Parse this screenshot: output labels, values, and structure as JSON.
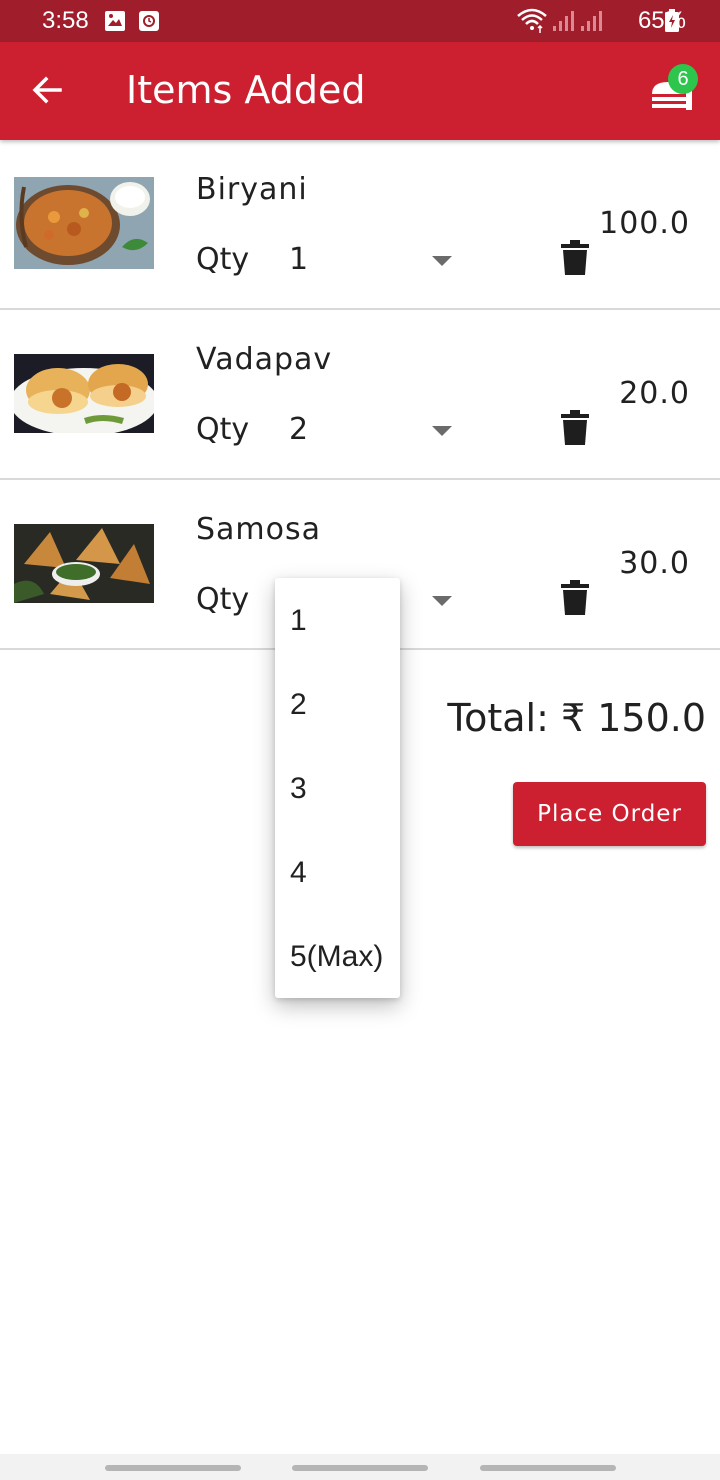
{
  "status_bar": {
    "time": "3:58",
    "battery": "65%",
    "icons": [
      "image-icon",
      "clock-icon",
      "wifi-icon",
      "signal-icon",
      "signal-icon",
      "battery-icon"
    ]
  },
  "app_bar": {
    "title": "Items Added",
    "cart_count": "6",
    "color": "#cc1f2f"
  },
  "items": [
    {
      "name": "Biryani",
      "qty_label": "Qty",
      "qty": "1",
      "price": "100.0"
    },
    {
      "name": "Vadapav",
      "qty_label": "Qty",
      "qty": "2",
      "price": "20.0"
    },
    {
      "name": "Samosa",
      "qty_label": "Qty",
      "qty": "",
      "price": "30.0"
    }
  ],
  "total": "Total: ₹ 150.0",
  "place_order_label": "Place Order",
  "dropdown": {
    "options": [
      "1",
      "2",
      "3",
      "4",
      "5(Max)"
    ]
  },
  "colors": {
    "accent": "#cc1f2f",
    "status_bar": "#a01e2c",
    "badge": "#2dc54b"
  }
}
